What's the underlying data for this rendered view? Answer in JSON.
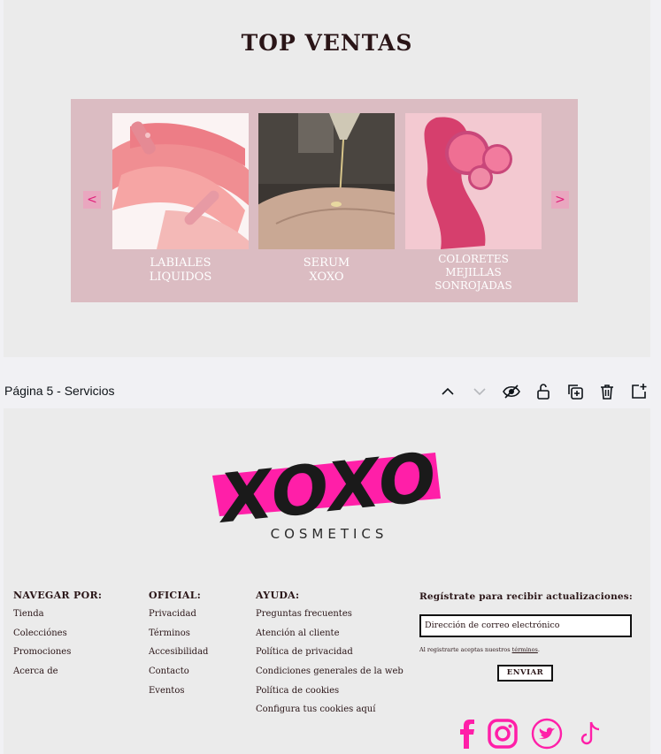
{
  "top_section": {
    "title": "TOP VENTAS",
    "products": [
      {
        "name_line1": "LABIALES",
        "name_line2": "LIQUIDOS",
        "name_line3": ""
      },
      {
        "name_line1": "SERUM",
        "name_line2": "XOXO",
        "name_line3": ""
      },
      {
        "name_line1": "COLORETES",
        "name_line2": "MEJILLAS",
        "name_line3": "SONROJADAS"
      }
    ],
    "prev_arrow": "<",
    "next_arrow": ">"
  },
  "toolbar": {
    "page_label": "Página 5 - Servicios",
    "icons": [
      "chevron-up-icon",
      "chevron-down-icon",
      "eye-hidden-icon",
      "lock-open-icon",
      "duplicate-icon",
      "trash-icon",
      "add-page-icon"
    ]
  },
  "footer": {
    "logo_text": "XOXO",
    "logo_sub": "COSMETICS",
    "nav": {
      "heading": "NAVEGAR POR:",
      "links": [
        "Tienda",
        "Colecciónes",
        "Promociones",
        "Acerca de"
      ]
    },
    "official": {
      "heading": "OFICIAL:",
      "links": [
        "Privacidad",
        "Términos",
        "Accesibilidad",
        "Contacto",
        "Eventos"
      ]
    },
    "help": {
      "heading": "AYUDA:",
      "links": [
        "Preguntas frecuentes",
        "Atención al cliente",
        "Política de privacidad",
        "Condiciones generales de la web",
        "Política de cookies",
        "Configura tus cookies aquí"
      ]
    },
    "newsletter": {
      "heading": "Regístrate para recibir actualizaciones:",
      "email_placeholder": "Dirección de correo electrónico",
      "note_prefix": "Al registrarte aceptas nuestros ",
      "note_link": "términos",
      "note_suffix": ".",
      "button": "ENVIAR"
    },
    "social_icons": [
      "facebook-icon",
      "instagram-icon",
      "twitter-icon",
      "tiktok-icon"
    ]
  },
  "colors": {
    "accent_pink": "#ff1fa8",
    "carousel_bg": "#dbbcc2",
    "text_dark": "#2a1517"
  }
}
